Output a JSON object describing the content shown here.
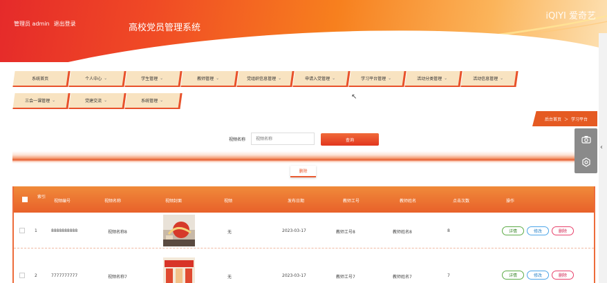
{
  "header": {
    "user_label": "管理员 admin",
    "logout_label": "退出登录",
    "title": "高校党员管理系统",
    "watermark": "iQIYI 爱奇艺"
  },
  "nav": {
    "items": [
      {
        "label": "系统首页",
        "dropdown": false
      },
      {
        "label": "个人中心",
        "dropdown": true
      },
      {
        "label": "学生管理",
        "dropdown": true
      },
      {
        "label": "教师管理",
        "dropdown": true
      },
      {
        "label": "党组织信息管理",
        "dropdown": true
      },
      {
        "label": "申请入党管理",
        "dropdown": true
      },
      {
        "label": "学习平台管理",
        "dropdown": true
      },
      {
        "label": "活动分类管理",
        "dropdown": true
      },
      {
        "label": "活动信息管理",
        "dropdown": true
      },
      {
        "label": "三会一课管理",
        "dropdown": true
      },
      {
        "label": "党建交流",
        "dropdown": true
      },
      {
        "label": "系统管理",
        "dropdown": true
      }
    ]
  },
  "breadcrumb": {
    "home": "后台首页",
    "separator": "＞",
    "current": "学习平台"
  },
  "search": {
    "label": "视频名称",
    "placeholder": "视频名称",
    "button": "查询"
  },
  "actions": {
    "delete_label": "删除"
  },
  "table": {
    "headers": [
      "索引",
      "视频编号",
      "视频名称",
      "视频封面",
      "视频",
      "发布日期",
      "教师工号",
      "教师姓名",
      "点击次数",
      "操作"
    ],
    "rows": [
      {
        "index": "1",
        "code": "8888888888",
        "name": "视频名称8",
        "video": "无",
        "date": "2023-03-17",
        "teacher_id": "教师工号8",
        "teacher_name": "教师姓名8",
        "clicks": "8"
      },
      {
        "index": "2",
        "code": "7777777777",
        "name": "视频名称7",
        "video": "无",
        "date": "2023-03-17",
        "teacher_id": "教师工号7",
        "teacher_name": "教师姓名7",
        "clicks": "7"
      }
    ],
    "op_labels": {
      "detail": "详情",
      "edit": "修改",
      "delete": "删除"
    }
  },
  "colors": {
    "accent": "#e8512b",
    "nav_bg": "#f8e3c1",
    "header_start": "#e52a2a",
    "header_end": "#fde2b5"
  },
  "icons": {
    "camera": "camera-icon",
    "target": "target-icon",
    "chevron": "chevron-down-icon"
  }
}
